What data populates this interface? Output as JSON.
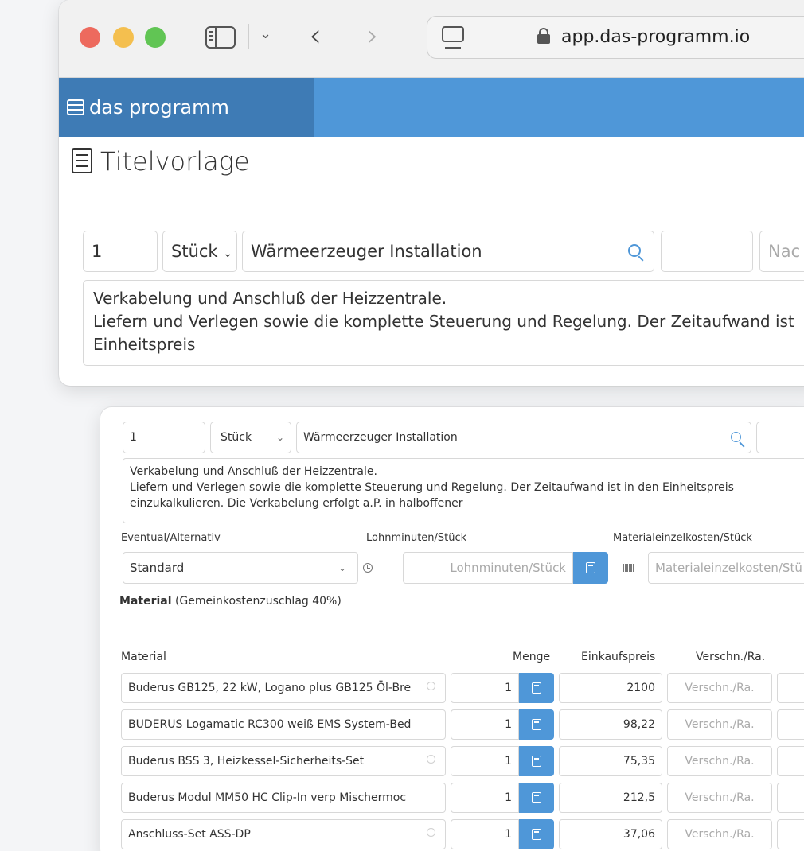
{
  "browser": {
    "url": "app.das-programm.io"
  },
  "app": {
    "brand": "das programm",
    "page_title": "Titelvorlage"
  },
  "top_form": {
    "quantity": "1",
    "unit": "Stück",
    "title": "Wärmeerzeuger Installation",
    "extra_placeholder": "Nac",
    "desc_line1": "Verkabelung und Anschluß der Heizzentrale.",
    "desc_line2": "Liefern und Verlegen sowie die komplette Steuerung und Regelung. Der Zeitaufwand ist",
    "desc_line3": "Einheitspreis"
  },
  "panel": {
    "quantity": "1",
    "unit": "Stück",
    "title": "Wärmeerzeuger Installation",
    "desc_line1": "Verkabelung und Anschluß der Heizzentrale.",
    "desc_line2": "Liefern und Verlegen sowie die komplette Steuerung und Regelung. Der Zeitaufwand ist in den Einheitspreis",
    "desc_line3": "einzukalkulieren. Die Verkabelung erfolgt a.P. in halboffener",
    "label_eventual": "Eventual/Alternativ",
    "eventual_value": "Standard",
    "label_lohn": "Lohnminuten/Stück",
    "lohn_placeholder": "Lohnminuten/Stück",
    "label_material_cost": "Materialeinzelkosten/Stück",
    "material_cost_placeholder": "Materialeinzelkosten/Stü",
    "section_title_bold": "Material",
    "section_title_rest": " (Gemeinkostenzuschlag 40%)",
    "col_material": "Material",
    "col_menge": "Menge",
    "col_einkauf": "Einkaufspreis",
    "col_verschn": "Verschn./Ra.",
    "verschn_placeholder": "Verschn./Ra.",
    "materials": [
      {
        "name": "Buderus GB125, 22 kW, Logano plus GB125 Öl-Bre",
        "qty": "1",
        "price": "2100"
      },
      {
        "name": "BUDERUS Logamatic RC300 weiß EMS System-Bed",
        "qty": "1",
        "price": "98,22"
      },
      {
        "name": "Buderus BSS 3, Heizkessel-Sicherheits-Set",
        "qty": "1",
        "price": "75,35"
      },
      {
        "name": "Buderus Modul MM50 HC Clip-In verp Mischermoc",
        "qty": "1",
        "price": "212,5"
      },
      {
        "name": "Anschluss-Set ASS-DP",
        "qty": "1",
        "price": "37,06"
      }
    ]
  },
  "colors": {
    "accent": "#4f97d8",
    "brand_dark": "#3e7bb5"
  }
}
